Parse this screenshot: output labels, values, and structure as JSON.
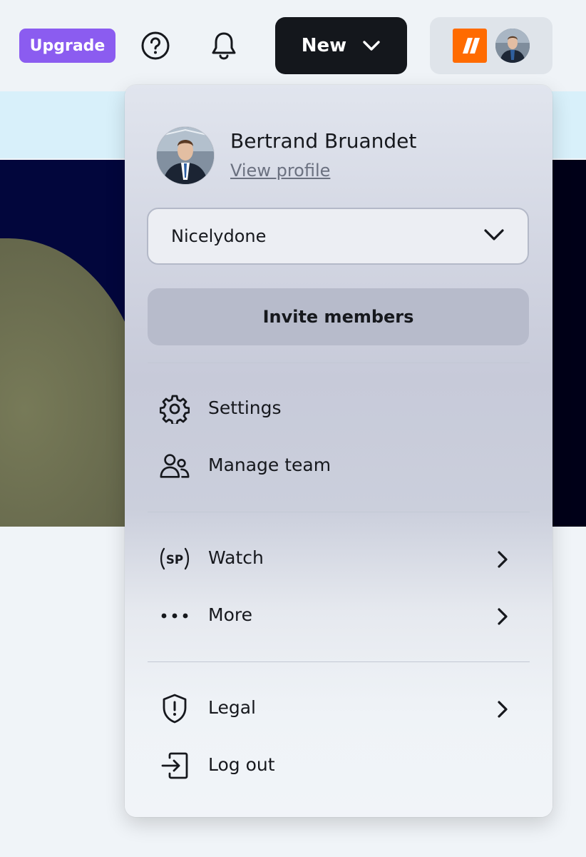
{
  "header": {
    "upgrade_label": "Upgrade",
    "new_label": "New",
    "accent_color": "#8b5cf0",
    "brand_color": "#ff6b00"
  },
  "profile": {
    "name": "Bertrand Bruandet",
    "view_profile_label": "View profile"
  },
  "workspace": {
    "selected": "Nicelydone"
  },
  "invite_label": "Invite members",
  "menu": {
    "settings": "Settings",
    "manage_team": "Manage team",
    "watch": "Watch",
    "watch_badge": "SP",
    "more": "More",
    "legal": "Legal",
    "logout": "Log out"
  }
}
